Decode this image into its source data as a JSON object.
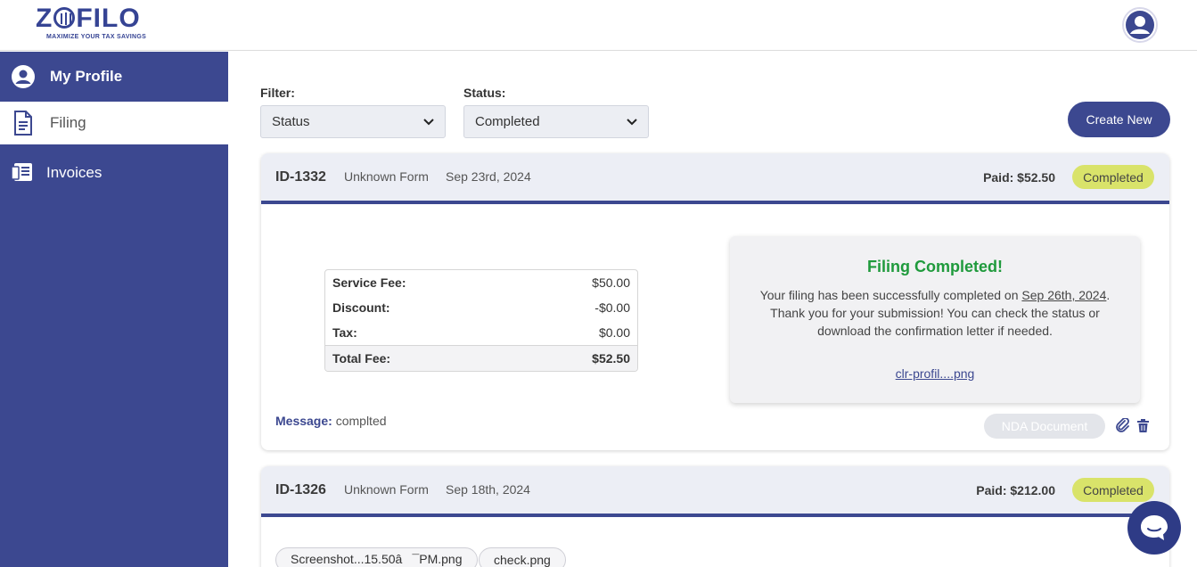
{
  "brand": {
    "name_left": "Z",
    "name_right": "FILO",
    "tagline": "MAXIMIZE YOUR TAX SAVINGS"
  },
  "sidebar": {
    "items": [
      {
        "label": "My Profile",
        "icon": "user-circle-icon",
        "active": false
      },
      {
        "label": "Filing",
        "icon": "document-icon",
        "active": true
      },
      {
        "label": "Invoices",
        "icon": "invoice-icon",
        "active": false
      }
    ]
  },
  "filters": {
    "filter_label": "Filter:",
    "filter_value": "Status",
    "status_label": "Status:",
    "status_value": "Completed"
  },
  "actions": {
    "create_new": "Create New"
  },
  "filings": [
    {
      "id": "ID-1332",
      "form": "Unknown Form",
      "date": "Sep 23rd, 2024",
      "paid": "Paid: $52.50",
      "status": "Completed",
      "fees": {
        "service_fee_label": "Service Fee:",
        "service_fee": "$50.00",
        "discount_label": "Discount:",
        "discount": "-$0.00",
        "tax_label": "Tax:",
        "tax": "$0.00",
        "total_label": "Total Fee:",
        "total": "$52.50"
      },
      "completion": {
        "title": "Filing Completed!",
        "text_before": "Your filing has been successfully completed on ",
        "completed_date": "Sep 26th, 2024",
        "text_after": ". Thank you for your submission! You can check the status or download the confirmation letter if needed.",
        "file_link": "clr-profil....png"
      },
      "message_label": "Message:",
      "message": "complted",
      "nda_button": "NDA Document"
    },
    {
      "id": "ID-1326",
      "form": "Unknown Form",
      "date": "Sep 18th, 2024",
      "paid": "Paid: $212.00",
      "status": "Completed",
      "attachments": [
        "Screenshot...15.50â¯PM.png",
        "check.png"
      ]
    }
  ],
  "colors": {
    "primary": "#3c4890",
    "badge": "#d9e36a",
    "success": "#1f9a3c",
    "card_header": "#eceef5"
  }
}
